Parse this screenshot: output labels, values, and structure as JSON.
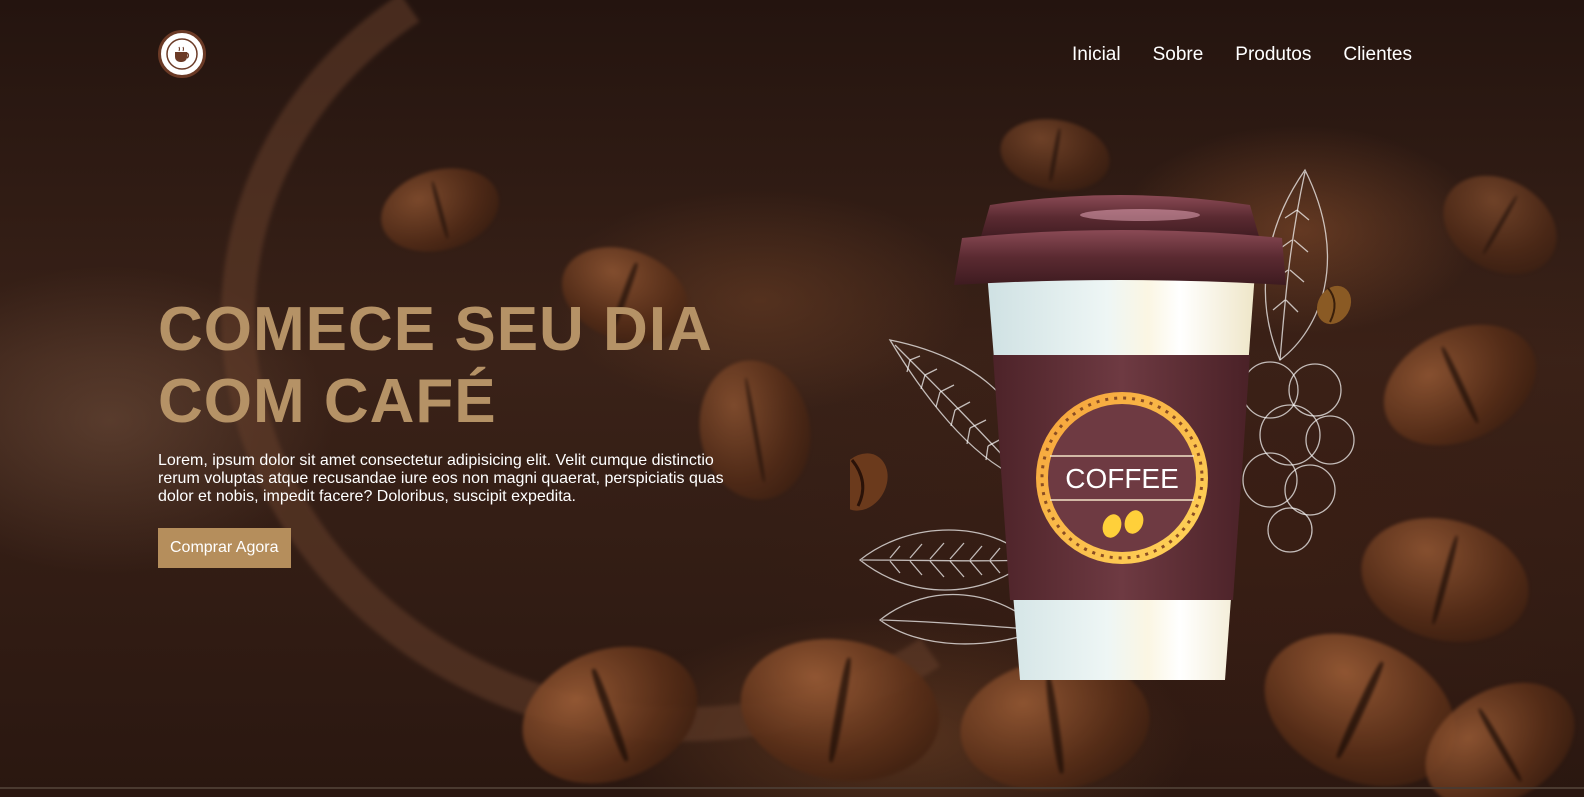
{
  "brand": {
    "logo_icon": "coffee-cup-logo-icon"
  },
  "nav": {
    "items": [
      {
        "label": "Inicial"
      },
      {
        "label": "Sobre"
      },
      {
        "label": "Produtos"
      },
      {
        "label": "Clientes"
      }
    ]
  },
  "hero": {
    "title_line1": "COMECE SEU DIA",
    "title_line2": "COM CAFÉ",
    "description": "Lorem, ipsum dolor sit amet consectetur adipisicing elit. Velit cumque distinctio rerum voluptas atque recusandae iure eos non magni quaerat, perspiciatis quas dolor et nobis, impedit facere? Doloribus, suscipit expedita.",
    "cta_label": "Comprar Agora"
  },
  "product": {
    "badge_text": "COFFEE",
    "icon": "coffee-cup-icon"
  },
  "colors": {
    "accent": "#b59266",
    "button": "#b58e5c",
    "cup_sleeve": "#6e3a42",
    "nav_text": "#ffffff"
  }
}
